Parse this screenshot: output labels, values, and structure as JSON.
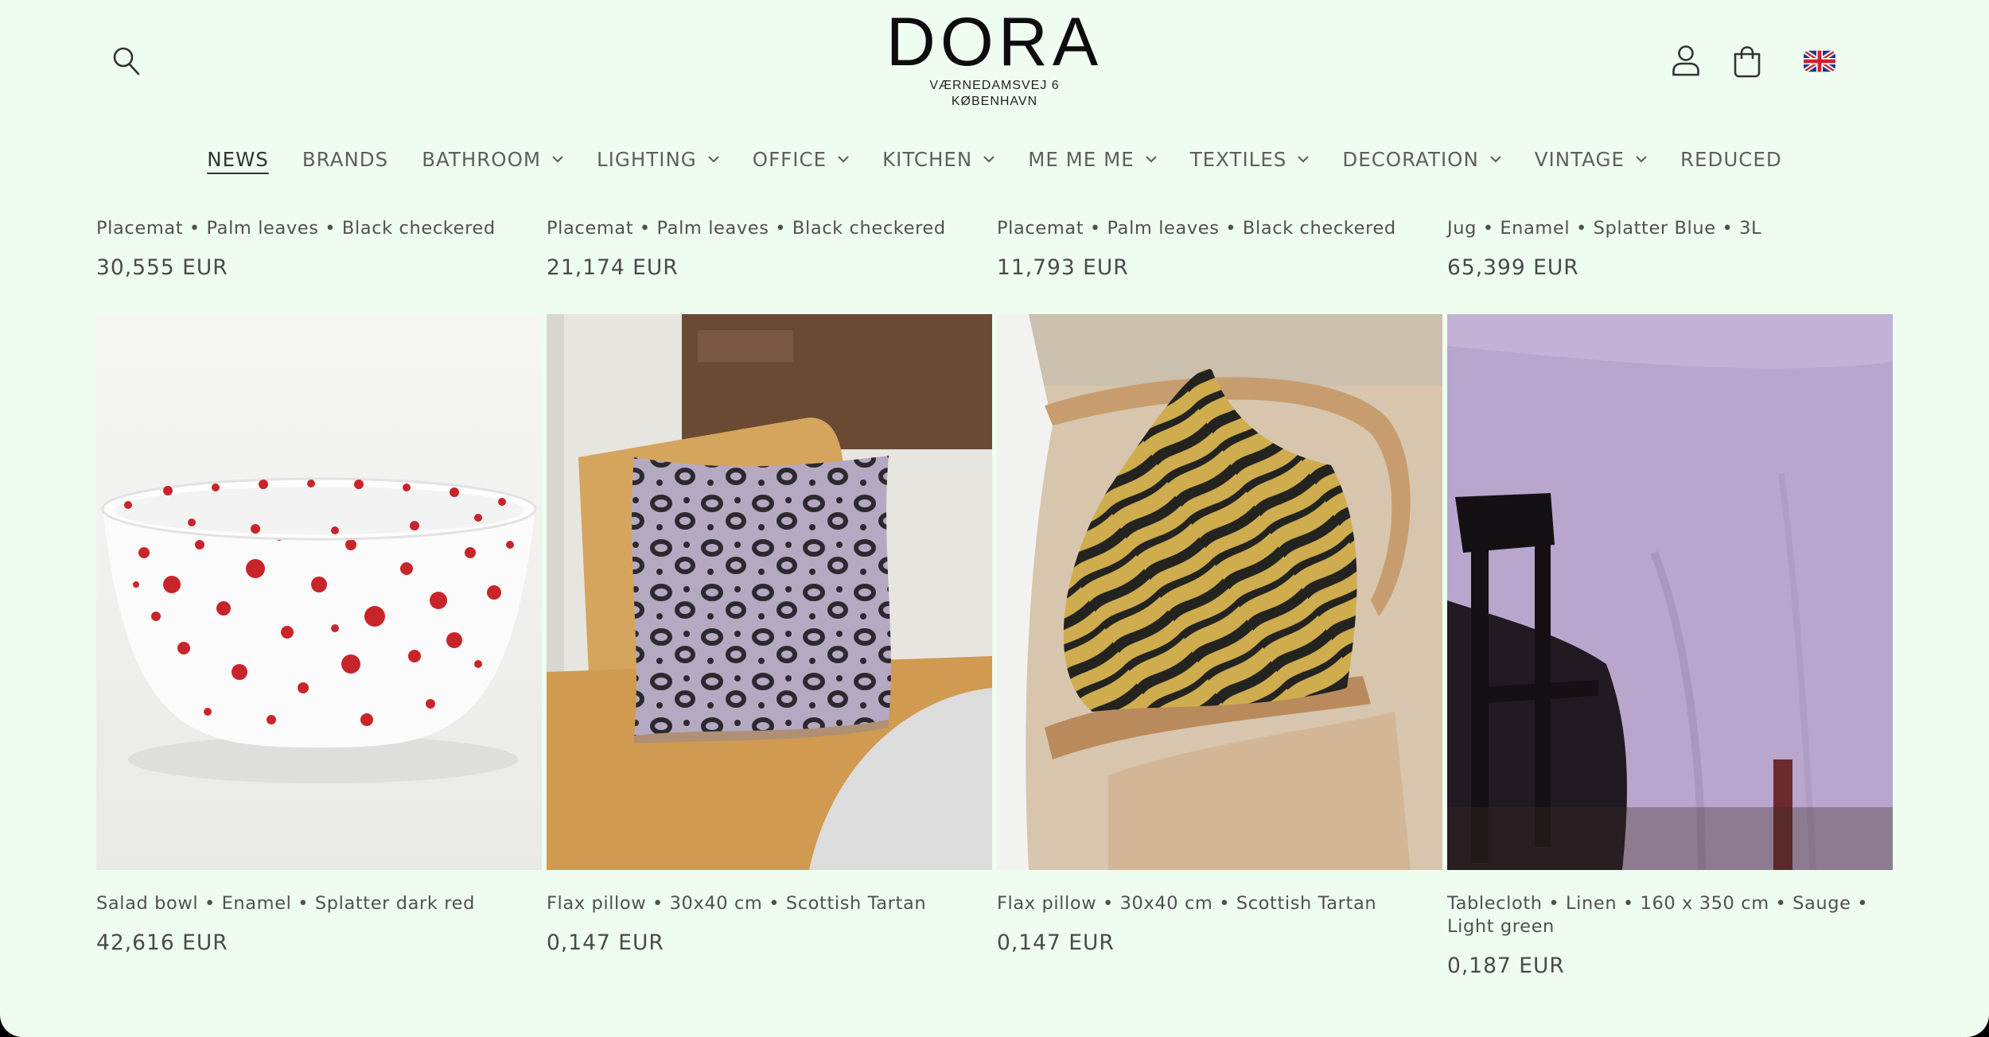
{
  "header": {
    "logo_name": "DORA",
    "logo_address_line1": "VÆRNEDAMSVEJ 6",
    "logo_address_line2": "KØBENHAVN",
    "search_icon": "search-icon",
    "account_icon": "user-icon",
    "cart_icon": "bag-icon",
    "language_flag": "uk-flag-icon"
  },
  "nav": {
    "items": [
      {
        "label": "NEWS",
        "dropdown": false,
        "active": true
      },
      {
        "label": "BRANDS",
        "dropdown": false
      },
      {
        "label": "BATHROOM",
        "dropdown": true
      },
      {
        "label": "LIGHTING",
        "dropdown": true
      },
      {
        "label": "OFFICE",
        "dropdown": true
      },
      {
        "label": "KITCHEN",
        "dropdown": true
      },
      {
        "label": "ME ME ME",
        "dropdown": true
      },
      {
        "label": "TEXTILES",
        "dropdown": true
      },
      {
        "label": "DECORATION",
        "dropdown": true
      },
      {
        "label": "VINTAGE",
        "dropdown": true
      },
      {
        "label": "REDUCED",
        "dropdown": false
      }
    ]
  },
  "products_top": [
    {
      "title": "Placemat • Palm leaves • Black checkered",
      "price": "30,555 EUR"
    },
    {
      "title": "Placemat • Palm leaves • Black checkered",
      "price": "21,174 EUR"
    },
    {
      "title": "Placemat • Palm leaves • Black checkered",
      "price": "11,793 EUR"
    },
    {
      "title": "Jug • Enamel • Splatter Blue • 3L",
      "price": "65,399 EUR"
    }
  ],
  "products": [
    {
      "title": "Salad bowl • Enamel • Splatter dark red",
      "price": "42,616 EUR",
      "image": "red-splatter-enamel-bowl"
    },
    {
      "title": "Flax pillow • 30x40 cm • Scottish Tartan",
      "price": "0,147 EUR",
      "image": "leopard-print-pillow-on-chair"
    },
    {
      "title": "Flax pillow • 30x40 cm • Scottish Tartan",
      "price": "0,147 EUR",
      "image": "tiger-stripe-pillow-on-chair"
    },
    {
      "title": "Tablecloth • Linen • 160 x 350 cm • Sauge • Light green",
      "price": "0,187 EUR",
      "image": "lilac-linen-tablecloth"
    }
  ]
}
